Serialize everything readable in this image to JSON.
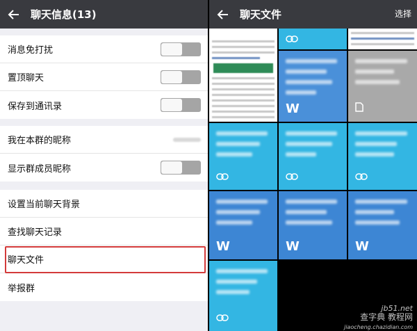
{
  "left": {
    "title": "聊天信息(13)",
    "groups": [
      [
        {
          "label": "消息免打扰",
          "toggle": false
        },
        {
          "label": "置顶聊天",
          "toggle": false
        },
        {
          "label": "保存到通讯录",
          "toggle": false
        }
      ],
      [
        {
          "label": "我在本群的昵称"
        },
        {
          "label": "显示群成员昵称",
          "toggle": false
        }
      ],
      [
        {
          "label": "设置当前聊天背景"
        },
        {
          "label": "查找聊天记录"
        },
        {
          "label": "聊天文件"
        },
        {
          "label": "举报群"
        }
      ]
    ]
  },
  "right": {
    "title": "聊天文件",
    "select_label": "选择",
    "tiles": [
      {
        "kind": "document"
      },
      {
        "kind": "link"
      },
      {
        "kind": "document"
      },
      {
        "kind": "word",
        "label": "W"
      },
      {
        "kind": "word",
        "label": "W"
      },
      {
        "kind": "file"
      },
      {
        "kind": "link"
      },
      {
        "kind": "link"
      },
      {
        "kind": "link"
      },
      {
        "kind": "word",
        "label": "W"
      },
      {
        "kind": "word",
        "label": "W"
      },
      {
        "kind": "word",
        "label": "W"
      },
      {
        "kind": "link"
      }
    ],
    "watermark": [
      "jb51.net",
      "查字典 教程网",
      "jiaocheng.chazidian.com"
    ]
  },
  "colors": {
    "topbar": "#393a3f",
    "highlight": "#d33a3a",
    "tile_blue": "#4a90d9",
    "tile_cyan": "#33b6e3"
  }
}
